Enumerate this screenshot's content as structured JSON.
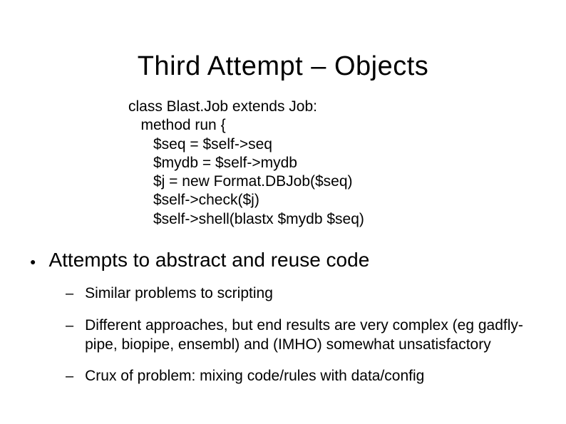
{
  "title": "Third Attempt – Objects",
  "code": {
    "l1": "class Blast.Job extends Job:",
    "l2": "   method run {",
    "l3": "      $seq = $self->seq",
    "l4": "      $mydb = $self->mydb",
    "l5": "      $j = new Format.DBJob($seq)",
    "l6": "      $self->check($j)",
    "l7": "      $self->shell(blastx $mydb $seq)"
  },
  "bullets": {
    "main": "Attempts to abstract and reuse code",
    "subs": [
      "Similar problems to scripting",
      "Different approaches, but end results are very complex (eg gadfly-pipe, biopipe, ensembl) and (IMHO) somewhat unsatisfactory",
      "Crux of problem: mixing code/rules with data/config"
    ]
  }
}
